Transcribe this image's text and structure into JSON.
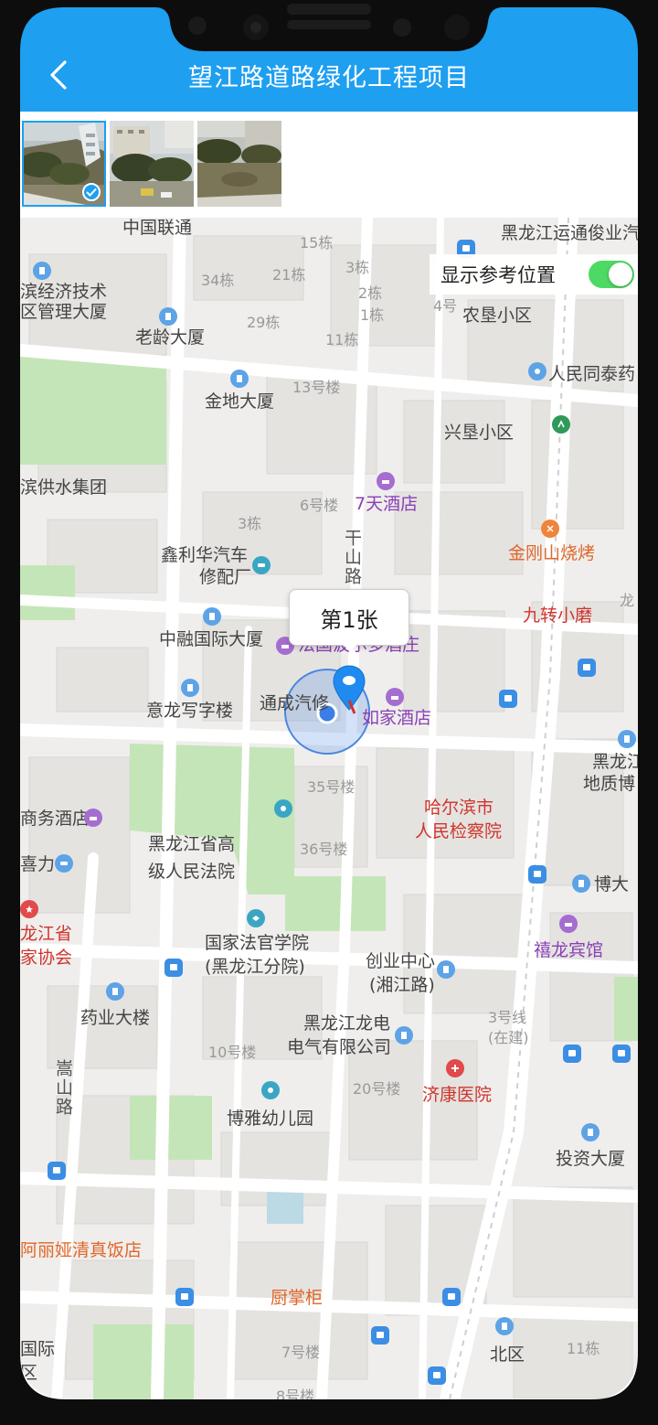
{
  "header": {
    "title": "望江路道路绿化工程项目",
    "back_icon": "chevron-left-icon"
  },
  "photos": {
    "items": [
      {
        "label": "photo-1",
        "selected": true
      },
      {
        "label": "photo-2",
        "selected": false
      },
      {
        "label": "photo-3",
        "selected": false
      }
    ]
  },
  "reference_toggle": {
    "label": "显示参考位置",
    "on": true,
    "color": "#4cd964"
  },
  "marker": {
    "callout": "第1张"
  },
  "map_labels": {
    "l01": "中国联通",
    "l02": "黑龙江运通俊业汽",
    "l03": "15栋",
    "l04": "34栋",
    "l05": "21栋",
    "l06": "3栋",
    "l07": "2栋",
    "l08": "4号",
    "l09": "1栋",
    "l10": "29栋",
    "l11": "农垦小区",
    "l12": "滨经济技术",
    "l13": "区管理大厦",
    "l14": "老龄大厦",
    "l15": "11栋",
    "l16": "人民同泰药",
    "l17": "13号楼",
    "l18": "金地大厦",
    "l19": "兴垦小区",
    "l20": "滨供水集团",
    "l21": "6号楼",
    "l22": "7天酒店",
    "l23": "3栋",
    "l24": "干山路",
    "l25": "鑫利华汽车",
    "l26": "修配厂",
    "l27": "金刚山烧烤",
    "l28": "中融国际大厦",
    "l29": "法国波尔多酒庄",
    "l30": "九转小磨",
    "l31": "意龙写字楼",
    "l32": "通成汽修",
    "l33": "如家酒店",
    "l34": "黑龙江",
    "l35": "地质博",
    "l36": "35号楼",
    "l37": "商务酒店",
    "l38": "哈尔滨市",
    "l39": "人民检察院",
    "l40": "黑龙江省高",
    "l41": "级人民法院",
    "l42": "36号楼",
    "l43": "喜力",
    "l44": "博大",
    "l45": "龙江省",
    "l46": "家协会",
    "l47": "国家法官学院",
    "l48": "(黑龙江分院)",
    "l49": "创业中心",
    "l50": "(湘江路)",
    "l51": "禧龙宾馆",
    "l52": "药业大楼",
    "l53": "3号线",
    "l54": "(在建)",
    "l55": "黑龙江龙电",
    "l56": "电气有限公司",
    "l57": "10号楼",
    "l58": "嵩山路",
    "l59": "济康医院",
    "l60": "20号楼",
    "l61": "博雅幼儿园",
    "l62": "投资大厦",
    "l63": "阿丽娅清真饭店",
    "l64": "厨掌柜",
    "l65": "国际",
    "l66": "区",
    "l67": "7号楼",
    "l68": "北区",
    "l69": "11栋",
    "l70": "8号楼",
    "l71": "龙"
  }
}
